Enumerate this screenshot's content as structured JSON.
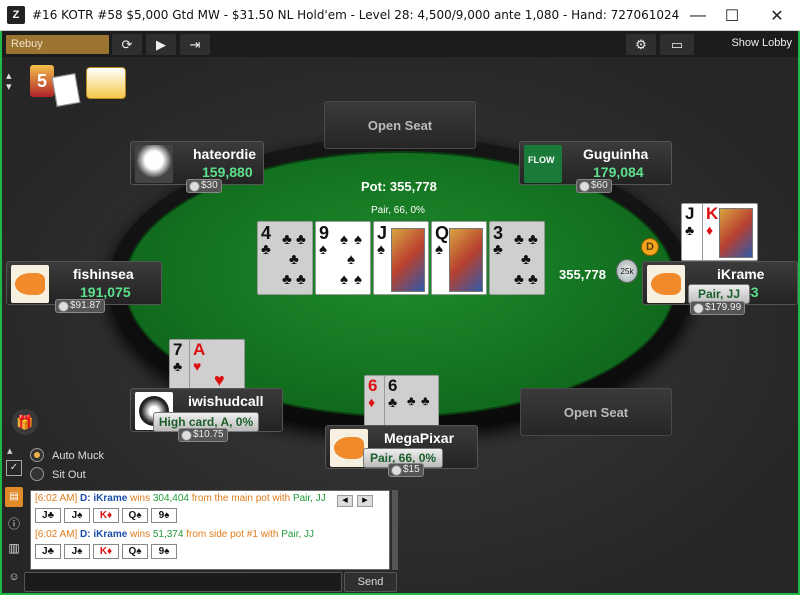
{
  "window": {
    "title": "#16 KOTR #58 $5,000 Gtd MW - $31.50 NL Hold'em - Level 28: 4,500/9,000 ante 1,080 - Hand: 727061024",
    "app_logo": "Z",
    "minimize": "—",
    "maximize": "☐",
    "close": "✕"
  },
  "toolbar": {
    "rebuy_label": "Rebuy",
    "show_lobby_label": "Show Lobby",
    "icons": [
      "refresh-icon",
      "play-icon",
      "exit-icon",
      "gear-icon",
      "layout-icon"
    ]
  },
  "table": {
    "pot_label": "Pot: 355,778",
    "hand_desc": "Pair, 66, 0%",
    "side_pot_amount": "355,778",
    "chip_stack_label": "25k",
    "dealer_label": "D",
    "open_seat_label_top": "Open Seat",
    "open_seat_label_right": "Open Seat",
    "board": [
      {
        "rank": "4",
        "suit": "♣",
        "color": "black",
        "dim": true
      },
      {
        "rank": "9",
        "suit": "♠",
        "color": "black",
        "dim": false
      },
      {
        "rank": "J",
        "suit": "♠",
        "color": "black",
        "dim": false
      },
      {
        "rank": "Q",
        "suit": "♠",
        "color": "black",
        "dim": false
      },
      {
        "rank": "3",
        "suit": "♣",
        "color": "black",
        "dim": true
      }
    ]
  },
  "players": {
    "hateordie": {
      "name": "hateordie",
      "stack": "159,880",
      "bet": "$30"
    },
    "guguinha": {
      "name": "Guguinha",
      "stack": "179,084",
      "bet": "$60"
    },
    "fishinsea": {
      "name": "fishinsea",
      "stack": "191,075",
      "bet": "$91.87"
    },
    "ikrame": {
      "name": "iKrame",
      "stack_partial": "43",
      "bet": "$179.99",
      "hand": "Pair, JJ",
      "cards": [
        {
          "rank": "J",
          "suit": "♣",
          "color": "black"
        },
        {
          "rank": "K",
          "suit": "♦",
          "color": "red"
        }
      ]
    },
    "iwishudcall": {
      "name": "iwishudcall",
      "hand": "High card, A, 0%",
      "bet": "$10.75",
      "cards": [
        {
          "rank": "7",
          "suit": "♣",
          "color": "black"
        },
        {
          "rank": "A",
          "suit": "♥",
          "color": "red"
        }
      ]
    },
    "megapixar": {
      "name": "MegaPixar",
      "hand": "Pair, 66, 0%",
      "bet": "$15",
      "cards": [
        {
          "rank": "6",
          "suit": "♦",
          "color": "red"
        },
        {
          "rank": "6",
          "suit": "♣",
          "color": "black"
        }
      ]
    }
  },
  "options": {
    "auto_muck": "Auto Muck",
    "sit_out": "Sit Out"
  },
  "chat": {
    "line1": {
      "time": "[6:02 AM]",
      "dealer": "D:",
      "player": "iKrame",
      "text1": " wins ",
      "amount": "304,404",
      "text2": " from the main pot with ",
      "hand": "Pair, JJ"
    },
    "line2": {
      "time": "[6:02 AM]",
      "dealer": "D:",
      "player": "iKrame",
      "text1": " wins ",
      "amount": "51,374",
      "text2": " from side pot #1 with ",
      "hand": "Pair, JJ"
    },
    "cards1": [
      "J♣",
      "J♠",
      "K♦",
      "Q♠",
      "9♠"
    ],
    "cards2": [
      "J♣",
      "J♠",
      "K♦",
      "Q♠",
      "9♠"
    ],
    "send_label": "Send",
    "nav_prev": "◀",
    "nav_next": "▶"
  }
}
